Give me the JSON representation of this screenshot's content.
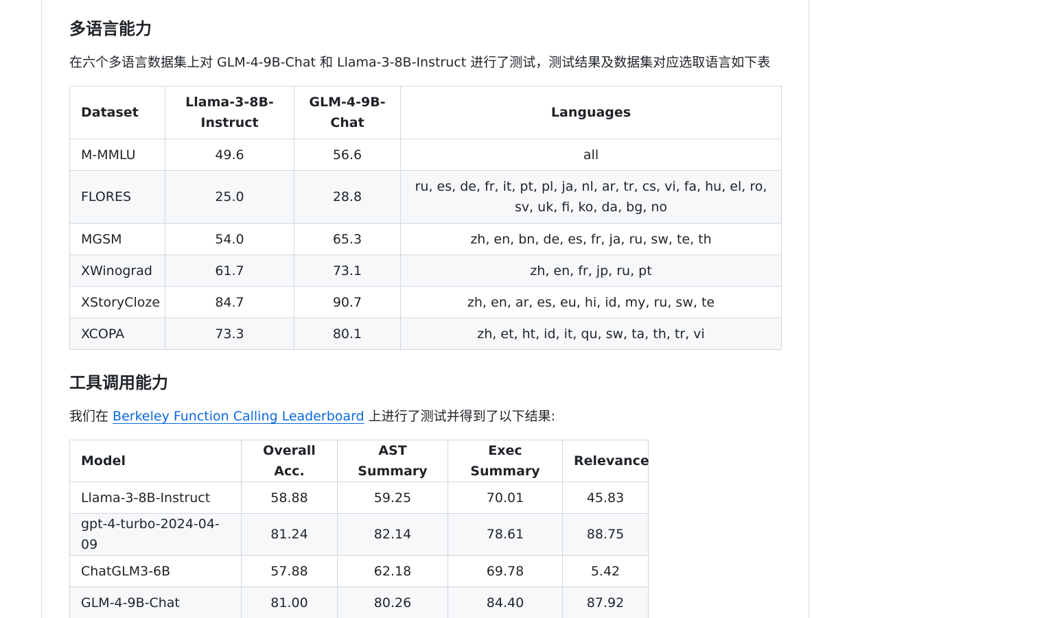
{
  "multilingual": {
    "heading": "多语言能力",
    "intro": "在六个多语言数据集上对 GLM-4-9B-Chat 和 Llama-3-8B-Instruct 进行了测试，测试结果及数据集对应选取语言如下表",
    "columns": [
      "Dataset",
      "Llama-3-8B-Instruct",
      "GLM-4-9B-Chat",
      "Languages"
    ],
    "rows": [
      [
        "M-MMLU",
        "49.6",
        "56.6",
        "all"
      ],
      [
        "FLORES",
        "25.0",
        "28.8",
        "ru, es, de, fr, it, pt, pl, ja, nl, ar, tr, cs, vi, fa, hu, el, ro, sv, uk, fi, ko, da, bg, no"
      ],
      [
        "MGSM",
        "54.0",
        "65.3",
        "zh, en, bn, de, es, fr, ja, ru, sw, te, th"
      ],
      [
        "XWinograd",
        "61.7",
        "73.1",
        "zh, en, fr, jp, ru, pt"
      ],
      [
        "XStoryCloze",
        "84.7",
        "90.7",
        "zh, en, ar, es, eu, hi, id, my, ru, sw, te"
      ],
      [
        "XCOPA",
        "73.3",
        "80.1",
        "zh, et, ht, id, it, qu, sw, ta, th, tr, vi"
      ]
    ]
  },
  "tool_calling": {
    "heading": "工具调用能力",
    "intro_before": "我们在 ",
    "link_text": "Berkeley Function Calling Leaderboard",
    "intro_after": " 上进行了测试并得到了以下结果:",
    "columns": [
      "Model",
      "Overall Acc.",
      "AST Summary",
      "Exec Summary",
      "Relevance"
    ],
    "rows": [
      [
        "Llama-3-8B-Instruct",
        "58.88",
        "59.25",
        "70.01",
        "45.83"
      ],
      [
        "gpt-4-turbo-2024-04-09",
        "81.24",
        "82.14",
        "78.61",
        "88.75"
      ],
      [
        "ChatGLM3-6B",
        "57.88",
        "62.18",
        "69.78",
        "5.42"
      ],
      [
        "GLM-4-9B-Chat",
        "81.00",
        "80.26",
        "84.40",
        "87.92"
      ]
    ]
  },
  "colors": {
    "link": "#0969da",
    "border": "#d0d7de",
    "row_alt": "#f6f8fa"
  }
}
